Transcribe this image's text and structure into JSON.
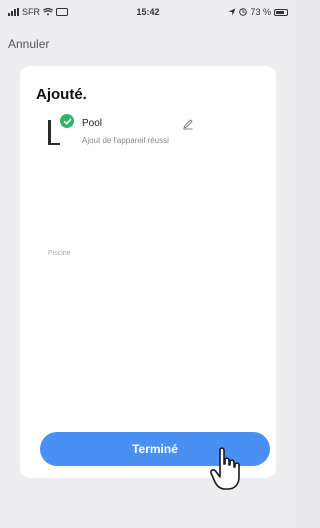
{
  "status_bar": {
    "carrier": "SFR",
    "time": "15:42",
    "battery": "73 %"
  },
  "nav": {
    "cancel_label": "Annuler"
  },
  "card": {
    "title": "Ajouté.",
    "device": {
      "name": "Pool",
      "status": "Ajout de l'appareil réussi"
    },
    "room_label": "Piscine"
  },
  "actions": {
    "done_label": "Terminé"
  },
  "colors": {
    "accent": "#4a8ff2",
    "success": "#2fb56a"
  }
}
